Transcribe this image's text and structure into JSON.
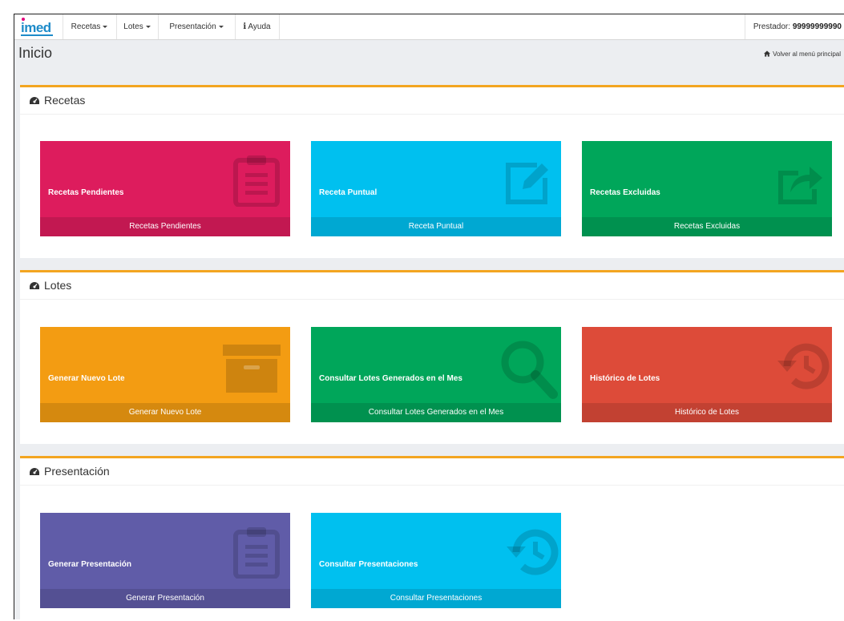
{
  "navbar": {
    "logo": "imed",
    "menus": [
      {
        "label": "Recetas"
      },
      {
        "label": "Lotes"
      },
      {
        "label": "Presentación"
      }
    ],
    "help": "Ayuda",
    "prestador_label": "Prestador:",
    "prestador_value": "99999999990"
  },
  "page": {
    "title": "Inicio",
    "breadcrumb": "Volver al menú principal"
  },
  "sections": [
    {
      "title": "Recetas",
      "tiles": [
        {
          "label": "Recetas Pendientes",
          "footer": "Recetas Pendientes",
          "color": "#dd1c5d",
          "icon": "clipboard-icon"
        },
        {
          "label": "Receta Puntual",
          "footer": "Receta Puntual",
          "color": "#00c0ef",
          "icon": "edit-icon"
        },
        {
          "label": "Recetas Excluidas",
          "footer": "Recetas Excluidas",
          "color": "#00a65a",
          "icon": "share-icon"
        }
      ]
    },
    {
      "title": "Lotes",
      "tiles": [
        {
          "label": "Generar Nuevo Lote",
          "footer": "Generar Nuevo Lote",
          "color": "#f39c12",
          "icon": "archive-icon"
        },
        {
          "label": "Consultar Lotes Generados en el Mes",
          "footer": "Consultar Lotes Generados en el Mes",
          "color": "#00a65a",
          "icon": "search-icon"
        },
        {
          "label": "Histórico de Lotes",
          "footer": "Histórico de Lotes",
          "color": "#dd4b39",
          "icon": "history-icon"
        }
      ]
    },
    {
      "title": "Presentación",
      "tiles": [
        {
          "label": "Generar Presentación",
          "footer": "Generar Presentación",
          "color": "#605ca8",
          "icon": "clipboard-icon"
        },
        {
          "label": "Consultar Presentaciones",
          "footer": "Consultar Presentaciones",
          "color": "#00c0ef",
          "icon": "history-icon"
        }
      ]
    }
  ]
}
